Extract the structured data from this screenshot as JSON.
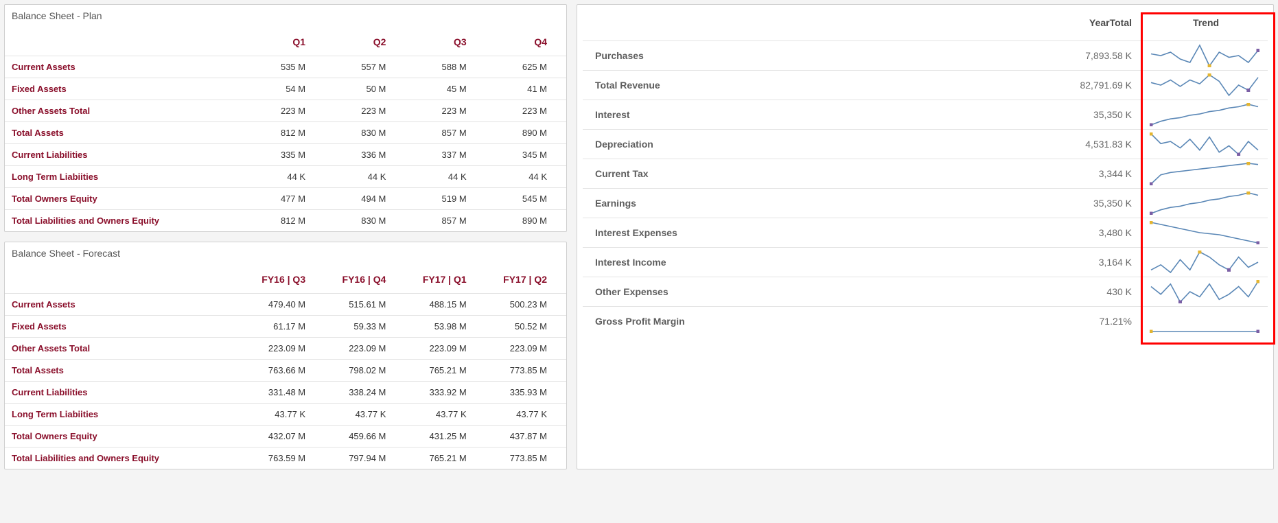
{
  "plan": {
    "title": "Balance Sheet - Plan",
    "columns": [
      "Q1",
      "Q2",
      "Q3",
      "Q4"
    ],
    "rows": [
      {
        "label": "Current Assets",
        "values": [
          "535 M",
          "557 M",
          "588 M",
          "625 M"
        ]
      },
      {
        "label": "Fixed Assets",
        "values": [
          "54 M",
          "50 M",
          "45 M",
          "41 M"
        ]
      },
      {
        "label": "Other Assets Total",
        "values": [
          "223 M",
          "223 M",
          "223 M",
          "223 M"
        ]
      },
      {
        "label": "Total Assets",
        "values": [
          "812 M",
          "830 M",
          "857 M",
          "890 M"
        ]
      },
      {
        "label": "Current Liabilities",
        "values": [
          "335 M",
          "336 M",
          "337 M",
          "345 M"
        ]
      },
      {
        "label": "Long Term Liabiities",
        "values": [
          "44 K",
          "44 K",
          "44 K",
          "44 K"
        ]
      },
      {
        "label": "Total Owners Equity",
        "values": [
          "477 M",
          "494 M",
          "519 M",
          "545 M"
        ]
      },
      {
        "label": "Total Liabilities and Owners Equity",
        "values": [
          "812 M",
          "830 M",
          "857 M",
          "890 M"
        ]
      }
    ]
  },
  "forecast": {
    "title": "Balance Sheet - Forecast",
    "columns": [
      "FY16 | Q3",
      "FY16 | Q4",
      "FY17 | Q1",
      "FY17 | Q2"
    ],
    "rows": [
      {
        "label": "Current Assets",
        "values": [
          "479.40 M",
          "515.61 M",
          "488.15 M",
          "500.23 M"
        ]
      },
      {
        "label": "Fixed Assets",
        "values": [
          "61.17 M",
          "59.33 M",
          "53.98 M",
          "50.52 M"
        ]
      },
      {
        "label": "Other Assets Total",
        "values": [
          "223.09 M",
          "223.09 M",
          "223.09 M",
          "223.09 M"
        ]
      },
      {
        "label": "Total Assets",
        "values": [
          "763.66 M",
          "798.02 M",
          "765.21 M",
          "773.85 M"
        ]
      },
      {
        "label": "Current Liabilities",
        "values": [
          "331.48 M",
          "338.24 M",
          "333.92 M",
          "335.93 M"
        ]
      },
      {
        "label": "Long Term Liabiities",
        "values": [
          "43.77 K",
          "43.77 K",
          "43.77 K",
          "43.77 K"
        ]
      },
      {
        "label": "Total Owners Equity",
        "values": [
          "432.07 M",
          "459.66 M",
          "431.25 M",
          "437.87 M"
        ]
      },
      {
        "label": "Total Liabilities and Owners Equity",
        "values": [
          "763.59 M",
          "797.94 M",
          "765.21 M",
          "773.85 M"
        ]
      }
    ]
  },
  "year_summary": {
    "headers": {
      "total": "YearTotal",
      "trend": "Trend"
    },
    "rows": [
      {
        "label": "Purchases",
        "value": "7,893.58 K",
        "spark": [
          20,
          18,
          22,
          14,
          10,
          30,
          6,
          22,
          16,
          18,
          10,
          24
        ],
        "max": 6,
        "min": 11
      },
      {
        "label": "Total Revenue",
        "value": "82,791.69 K",
        "spark": [
          16,
          14,
          18,
          13,
          18,
          15,
          22,
          17,
          6,
          14,
          10,
          20
        ],
        "max": 6,
        "min": 10
      },
      {
        "label": "Interest",
        "value": "35,350 K",
        "spark": [
          6,
          9,
          11,
          12,
          14,
          15,
          17,
          18,
          20,
          21,
          23,
          21
        ],
        "max": 10,
        "min": 0
      },
      {
        "label": "Depreciation",
        "value": "4,531.83 K",
        "spark": [
          25,
          16,
          18,
          12,
          20,
          10,
          22,
          8,
          14,
          6,
          18,
          10
        ],
        "max": 0,
        "min": 9
      },
      {
        "label": "Current Tax",
        "value": "3,344 K",
        "spark": [
          4,
          12,
          14,
          15,
          16,
          17,
          18,
          19,
          20,
          21,
          22,
          21
        ],
        "max": 10,
        "min": 0
      },
      {
        "label": "Earnings",
        "value": "35,350 K",
        "spark": [
          6,
          9,
          11,
          12,
          14,
          15,
          17,
          18,
          20,
          21,
          23,
          21
        ],
        "max": 10,
        "min": 0
      },
      {
        "label": "Interest Expenses",
        "value": "3,480 K",
        "spark": [
          24,
          22,
          20,
          18,
          16,
          14,
          13,
          12,
          10,
          8,
          6,
          4
        ],
        "max": 0,
        "min": 11
      },
      {
        "label": "Interest Income",
        "value": "3,164 K",
        "spark": [
          10,
          14,
          8,
          18,
          10,
          24,
          20,
          14,
          10,
          20,
          12,
          16
        ],
        "max": 5,
        "min": 8
      },
      {
        "label": "Other Expenses",
        "value": "430 K",
        "spark": [
          20,
          14,
          22,
          8,
          16,
          12,
          22,
          10,
          14,
          20,
          12,
          24
        ],
        "max": 11,
        "min": 3
      },
      {
        "label": "Gross Profit Margin",
        "value": "71.21%",
        "spark": [
          12,
          12,
          12,
          12,
          12,
          12,
          12,
          12,
          12,
          12,
          12,
          12
        ],
        "max": 0,
        "min": 11
      }
    ]
  },
  "chart_data": [
    {
      "type": "line",
      "title": "Purchases trend",
      "x": [
        1,
        2,
        3,
        4,
        5,
        6,
        7,
        8,
        9,
        10,
        11,
        12
      ],
      "values": [
        20,
        18,
        22,
        14,
        10,
        30,
        6,
        22,
        16,
        18,
        10,
        24
      ],
      "xlabel": "",
      "ylabel": ""
    },
    {
      "type": "line",
      "title": "Total Revenue trend",
      "x": [
        1,
        2,
        3,
        4,
        5,
        6,
        7,
        8,
        9,
        10,
        11,
        12
      ],
      "values": [
        16,
        14,
        18,
        13,
        18,
        15,
        22,
        17,
        6,
        14,
        10,
        20
      ],
      "xlabel": "",
      "ylabel": ""
    },
    {
      "type": "line",
      "title": "Interest trend",
      "x": [
        1,
        2,
        3,
        4,
        5,
        6,
        7,
        8,
        9,
        10,
        11,
        12
      ],
      "values": [
        6,
        9,
        11,
        12,
        14,
        15,
        17,
        18,
        20,
        21,
        23,
        21
      ],
      "xlabel": "",
      "ylabel": ""
    },
    {
      "type": "line",
      "title": "Depreciation trend",
      "x": [
        1,
        2,
        3,
        4,
        5,
        6,
        7,
        8,
        9,
        10,
        11,
        12
      ],
      "values": [
        25,
        16,
        18,
        12,
        20,
        10,
        22,
        8,
        14,
        6,
        18,
        10
      ],
      "xlabel": "",
      "ylabel": ""
    },
    {
      "type": "line",
      "title": "Current Tax trend",
      "x": [
        1,
        2,
        3,
        4,
        5,
        6,
        7,
        8,
        9,
        10,
        11,
        12
      ],
      "values": [
        4,
        12,
        14,
        15,
        16,
        17,
        18,
        19,
        20,
        21,
        22,
        21
      ],
      "xlabel": "",
      "ylabel": ""
    },
    {
      "type": "line",
      "title": "Earnings trend",
      "x": [
        1,
        2,
        3,
        4,
        5,
        6,
        7,
        8,
        9,
        10,
        11,
        12
      ],
      "values": [
        6,
        9,
        11,
        12,
        14,
        15,
        17,
        18,
        20,
        21,
        23,
        21
      ],
      "xlabel": "",
      "ylabel": ""
    },
    {
      "type": "line",
      "title": "Interest Expenses trend",
      "x": [
        1,
        2,
        3,
        4,
        5,
        6,
        7,
        8,
        9,
        10,
        11,
        12
      ],
      "values": [
        24,
        22,
        20,
        18,
        16,
        14,
        13,
        12,
        10,
        8,
        6,
        4
      ],
      "xlabel": "",
      "ylabel": ""
    },
    {
      "type": "line",
      "title": "Interest Income trend",
      "x": [
        1,
        2,
        3,
        4,
        5,
        6,
        7,
        8,
        9,
        10,
        11,
        12
      ],
      "values": [
        10,
        14,
        8,
        18,
        10,
        24,
        20,
        14,
        10,
        20,
        12,
        16
      ],
      "xlabel": "",
      "ylabel": ""
    },
    {
      "type": "line",
      "title": "Other Expenses trend",
      "x": [
        1,
        2,
        3,
        4,
        5,
        6,
        7,
        8,
        9,
        10,
        11,
        12
      ],
      "values": [
        20,
        14,
        22,
        8,
        16,
        12,
        22,
        10,
        14,
        20,
        12,
        24
      ],
      "xlabel": "",
      "ylabel": ""
    },
    {
      "type": "line",
      "title": "Gross Profit Margin trend",
      "x": [
        1,
        2,
        3,
        4,
        5,
        6,
        7,
        8,
        9,
        10,
        11,
        12
      ],
      "values": [
        12,
        12,
        12,
        12,
        12,
        12,
        12,
        12,
        12,
        12,
        12,
        12
      ],
      "xlabel": "",
      "ylabel": ""
    }
  ]
}
